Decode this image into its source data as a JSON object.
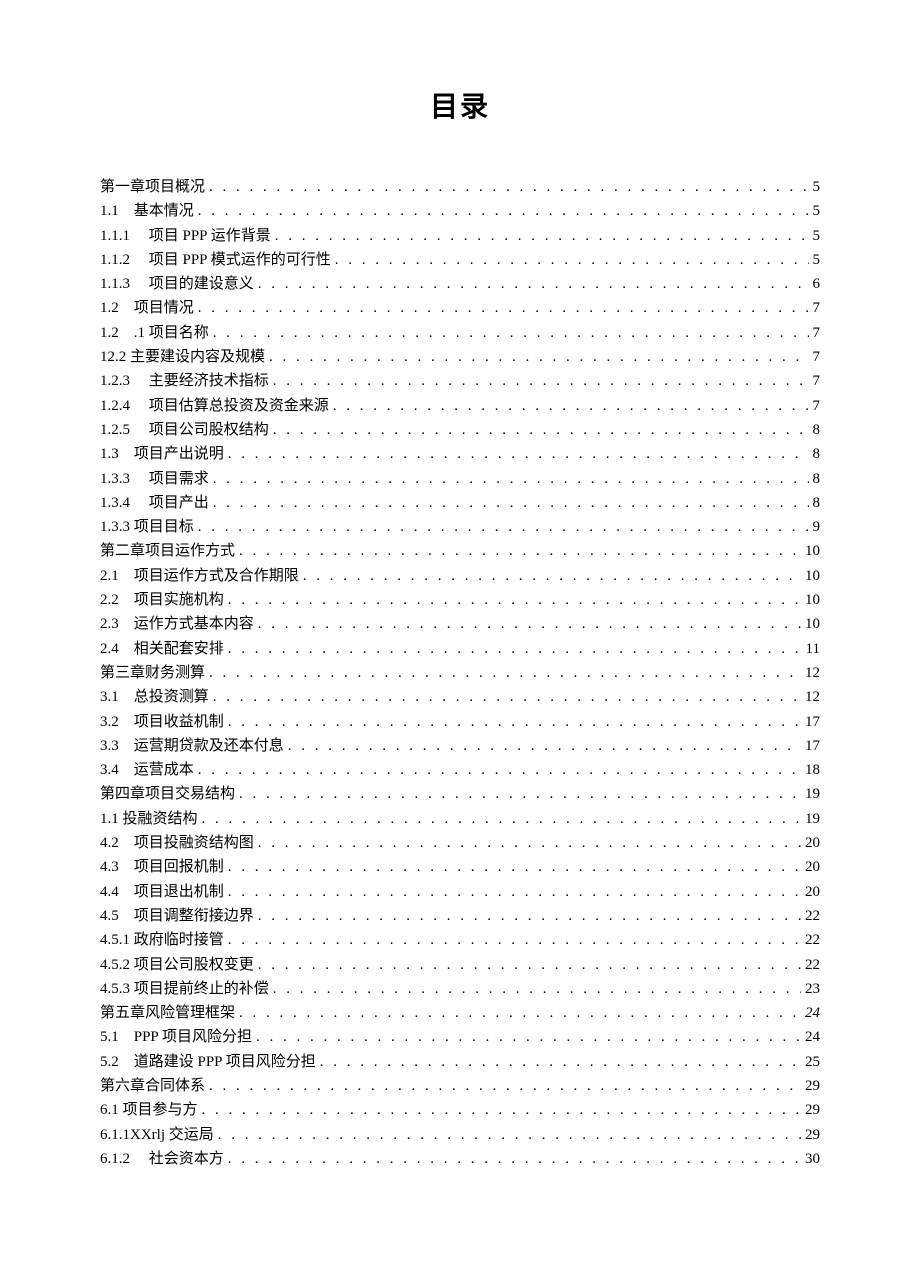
{
  "title": "目录",
  "entries": [
    {
      "label": "第一章项目概况",
      "page": "5"
    },
    {
      "label": "1.1　基本情况",
      "page": "5"
    },
    {
      "label": "1.1.1　 项目 PPP 运作背景",
      "page": "5"
    },
    {
      "label": "1.1.2　 项目 PPP 模式运作的可行性",
      "page": "5"
    },
    {
      "label": "1.1.3　 项目的建设意义",
      "page": "6"
    },
    {
      "label": "1.2　项目情况",
      "page": "7"
    },
    {
      "label": "1.2　.1 项目名称",
      "page": "7"
    },
    {
      "label": "12.2 主要建设内容及规模",
      "page": "7"
    },
    {
      "label": "1.2.3　 主要经济技术指标",
      "page": "7"
    },
    {
      "label": "1.2.4　 项目估算总投资及资金来源",
      "page": "7"
    },
    {
      "label": "1.2.5　 项目公司股权结构",
      "page": "8"
    },
    {
      "label": "1.3　项目产出说明",
      "page": "8"
    },
    {
      "label": "1.3.3　 项目需求",
      "page": "8"
    },
    {
      "label": "1.3.4　 项目产出",
      "page": "8"
    },
    {
      "label": "1.3.3 项目目标",
      "page": "9"
    },
    {
      "label": "第二章项目运作方式",
      "page": "10"
    },
    {
      "label": "2.1　项目运作方式及合作期限",
      "page": "10"
    },
    {
      "label": "2.2　项目实施机构",
      "page": "10"
    },
    {
      "label": "2.3　运作方式基本内容",
      "page": "10"
    },
    {
      "label": "2.4　相关配套安排",
      "page": "11"
    },
    {
      "label": "第三章财务测算",
      "page": "12"
    },
    {
      "label": "3.1　总投资测算",
      "page": "12"
    },
    {
      "label": "3.2　项目收益机制",
      "page": "17"
    },
    {
      "label": "3.3　运营期贷款及还本付息",
      "page": "17"
    },
    {
      "label": "3.4　运营成本",
      "page": "18"
    },
    {
      "label": "第四章项目交易结构",
      "page": "19"
    },
    {
      "label": "1.1 投融资结构",
      "page": "19"
    },
    {
      "label": "4.2　项目投融资结构图",
      "page": "20"
    },
    {
      "label": "4.3　项目回报机制",
      "page": "20"
    },
    {
      "label": "4.4　项目退出机制",
      "page": "20"
    },
    {
      "label": "4.5　项目调整衔接边界",
      "page": "22"
    },
    {
      "label": "4.5.1 政府临时接管",
      "page": "22"
    },
    {
      "label": "4.5.2 项目公司股权变更",
      "page": "22"
    },
    {
      "label": "4.5.3 项目提前终止的补偿",
      "page": "23"
    },
    {
      "label": "第五章风险管理框架",
      "page": "24",
      "italic": true
    },
    {
      "label": "5.1　PPP 项目风险分担",
      "page": "24"
    },
    {
      "label": "5.2　道路建设 PPP 项目风险分担",
      "page": "25"
    },
    {
      "label": "第六章合同体系",
      "page": "29"
    },
    {
      "label": "6.1 项目参与方",
      "page": "29"
    },
    {
      "label": "6.1.1XXrlj 交运局",
      "page": "29"
    },
    {
      "label": "6.1.2　 社会资本方",
      "page": "30"
    }
  ]
}
